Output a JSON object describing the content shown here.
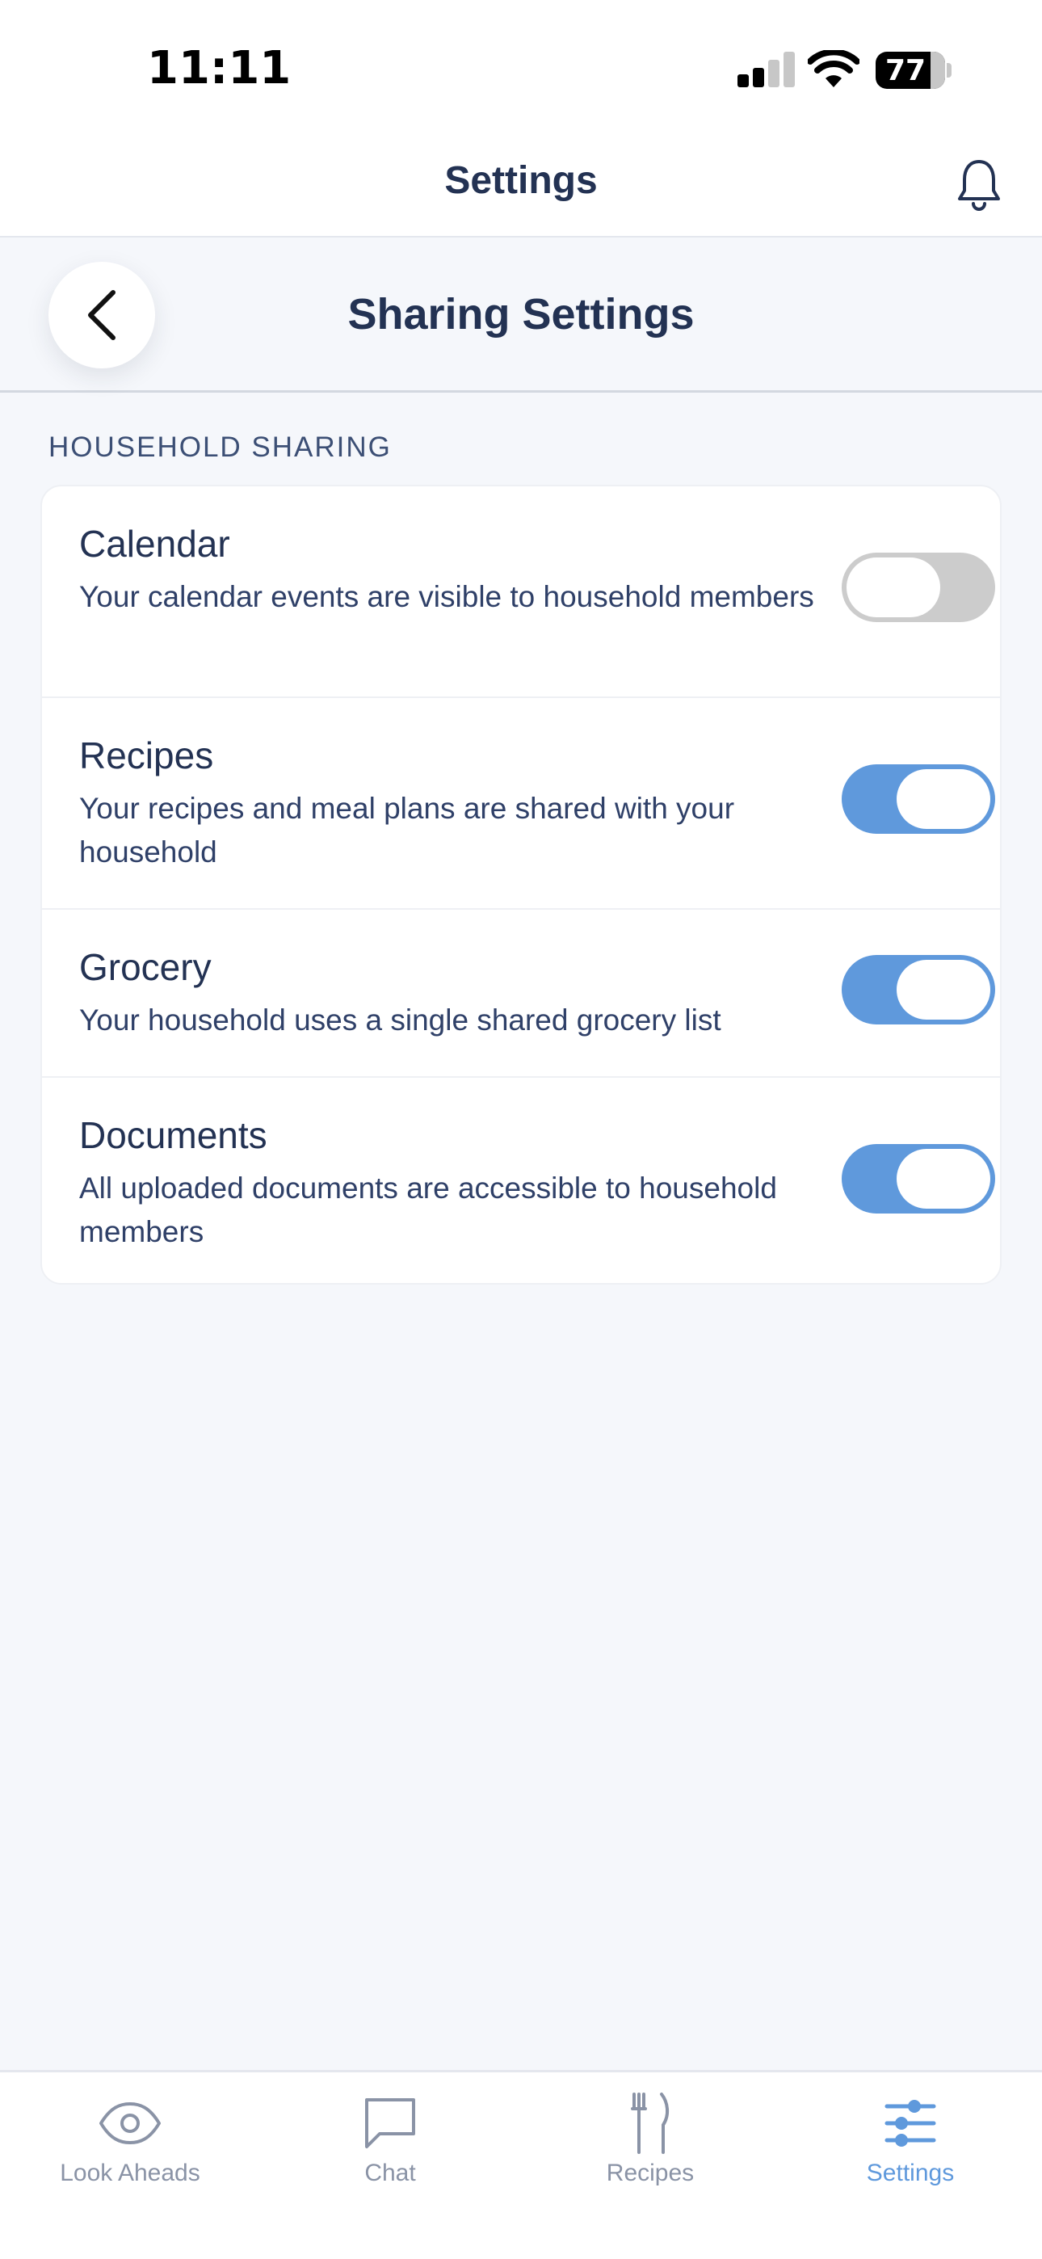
{
  "status_bar": {
    "time": "11:11",
    "battery": "77"
  },
  "header": {
    "title": "Settings"
  },
  "sub_header": {
    "title": "Sharing Settings"
  },
  "section": {
    "label": "HOUSEHOLD SHARING"
  },
  "rows": [
    {
      "title": "Calendar",
      "description": "Your calendar events are visible to household members",
      "enabled": false
    },
    {
      "title": "Recipes",
      "description": "Your recipes and meal plans are shared with your household",
      "enabled": true
    },
    {
      "title": "Grocery",
      "description": "Your household uses a single shared grocery list",
      "enabled": true
    },
    {
      "title": "Documents",
      "description": "All uploaded documents are accessible to household members",
      "enabled": true
    }
  ],
  "tabs": [
    {
      "label": "Look Aheads",
      "icon": "eye-icon"
    },
    {
      "label": "Chat",
      "icon": "chat-bubble-icon"
    },
    {
      "label": "Recipes",
      "icon": "fork-knife-icon"
    },
    {
      "label": "Settings",
      "icon": "sliders-icon",
      "active": true
    }
  ],
  "colors": {
    "accent": "#5f99dc",
    "text": "#233253",
    "toggle_off": "#cccccc",
    "background": "#f5f7fb"
  }
}
